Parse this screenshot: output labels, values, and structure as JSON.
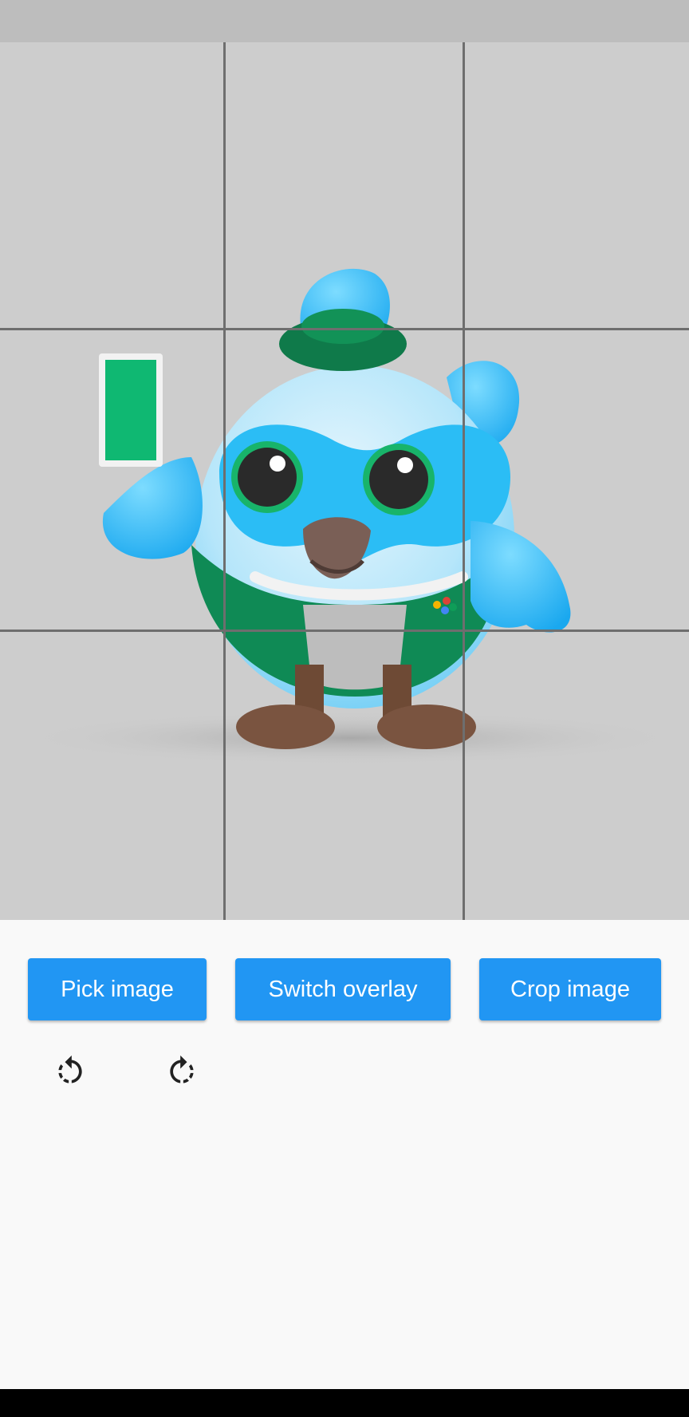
{
  "crop_view": {
    "image_subject": "bird-mascot-illustration",
    "overlay": "rule-of-thirds-grid"
  },
  "controls": {
    "pick_label": "Pick image",
    "switch_label": "Switch overlay",
    "crop_label": "Crop image",
    "rotate_left_icon": "rotate-left-icon",
    "rotate_right_icon": "rotate-right-icon"
  },
  "colors": {
    "button": "#2196f3",
    "button_text": "#ffffff",
    "canvas": "#cdcdcd",
    "grid": "#6e6e6e"
  }
}
